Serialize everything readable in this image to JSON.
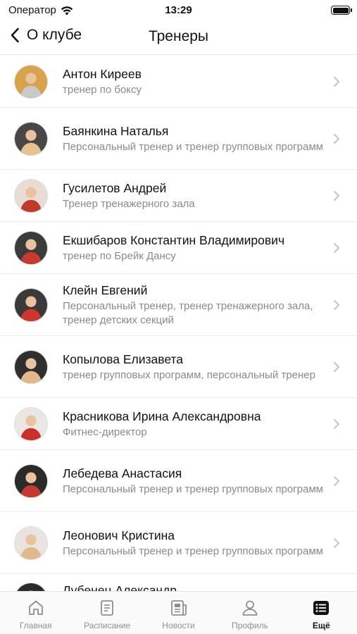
{
  "status_bar": {
    "carrier": "Оператор",
    "time": "13:29"
  },
  "nav": {
    "back_label": "О клубе",
    "title": "Тренеры"
  },
  "trainers": [
    {
      "name": "Антон Киреев",
      "role": "тренер по боксу",
      "avatar_bg": "#d8a24a",
      "avatar_fg": "#c9c9c9"
    },
    {
      "name": "Баянкина Наталья",
      "role": "Персональный тренер и тренер групповых программ",
      "avatar_bg": "#4a4648",
      "avatar_fg": "#e8c28c"
    },
    {
      "name": "Гусилетов Андрей",
      "role": "Тренер тренажерного зала",
      "avatar_bg": "#e7ddd5",
      "avatar_fg": "#c0392b"
    },
    {
      "name": "Екшибаров Константин Владимирович",
      "role": "тренер по Брейк Дансу",
      "avatar_bg": "#3b3b3b",
      "avatar_fg": "#c73b2f"
    },
    {
      "name": "Клейн Евгений",
      "role": "Персональный тренер, тренер тренажерного зала, тренер детских секций",
      "avatar_bg": "#3a3a3a",
      "avatar_fg": "#d0342c"
    },
    {
      "name": "Копылова Елизавета",
      "role": "тренер групповых программ, персональный тренер",
      "avatar_bg": "#2f2f2f",
      "avatar_fg": "#e3b98c"
    },
    {
      "name": "Красникова Ирина Александровна",
      "role": "Фитнес-директор",
      "avatar_bg": "#eae6e3",
      "avatar_fg": "#c9302c"
    },
    {
      "name": "Лебедева Анастасия",
      "role": "Персональный тренер и тренер групповых программ",
      "avatar_bg": "#2a2a2a",
      "avatar_fg": "#c23a30"
    },
    {
      "name": "Леонович Кристина",
      "role": "Персональный тренер и тренер групповых программ",
      "avatar_bg": "#e9e4df",
      "avatar_fg": "#e0b98a"
    },
    {
      "name": "Лубенец Александр",
      "role": "",
      "avatar_bg": "#2b2b2b",
      "avatar_fg": "#555555"
    }
  ],
  "tabs": [
    {
      "label": "Главная",
      "icon": "home-icon",
      "active": false
    },
    {
      "label": "Расписание",
      "icon": "schedule-icon",
      "active": false
    },
    {
      "label": "Новости",
      "icon": "news-icon",
      "active": false
    },
    {
      "label": "Профиль",
      "icon": "profile-icon",
      "active": false
    },
    {
      "label": "Ещё",
      "icon": "more-icon",
      "active": true
    }
  ]
}
